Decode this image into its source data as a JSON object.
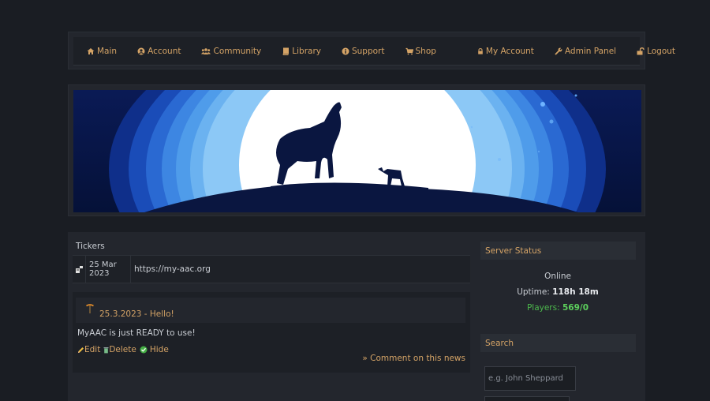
{
  "nav": {
    "left": [
      {
        "label": "Main",
        "icon": "home-icon"
      },
      {
        "label": "Account",
        "icon": "user-circle-icon"
      },
      {
        "label": "Community",
        "icon": "users-icon"
      },
      {
        "label": "Library",
        "icon": "book-icon"
      },
      {
        "label": "Support",
        "icon": "info-circle-icon"
      },
      {
        "label": "Shop",
        "icon": "cart-icon"
      }
    ],
    "right": [
      {
        "label": "My Account",
        "icon": "lock-icon"
      },
      {
        "label": "Admin Panel",
        "icon": "wrench-icon"
      },
      {
        "label": "Logout",
        "icon": "unlock-icon"
      }
    ]
  },
  "tickers": {
    "title": "Tickers",
    "items": [
      {
        "day": "25 Mar",
        "year": "2023",
        "text": "https://my-aac.org",
        "icon": "ticker-icon"
      }
    ]
  },
  "news": {
    "title": "25.3.2023 - Hello!",
    "icon": "pickaxe-icon",
    "body": "MyAAC is just READY to use!",
    "edit_label": "Edit",
    "delete_label": "Delete",
    "hide_label": "Hide",
    "comment_label": "» Comment on this news"
  },
  "server_status": {
    "title": "Server Status",
    "state": "Online",
    "uptime_label": "Uptime:",
    "uptime_value": "118h 18m",
    "players_label": "Players:",
    "players_value": "569/0"
  },
  "search": {
    "title": "Search",
    "placeholder": "e.g. John Sheppard"
  },
  "colors": {
    "background": "#1a1d23",
    "panel": "#23262d",
    "link": "#d4a366",
    "online_green": "#5ccf5c"
  }
}
